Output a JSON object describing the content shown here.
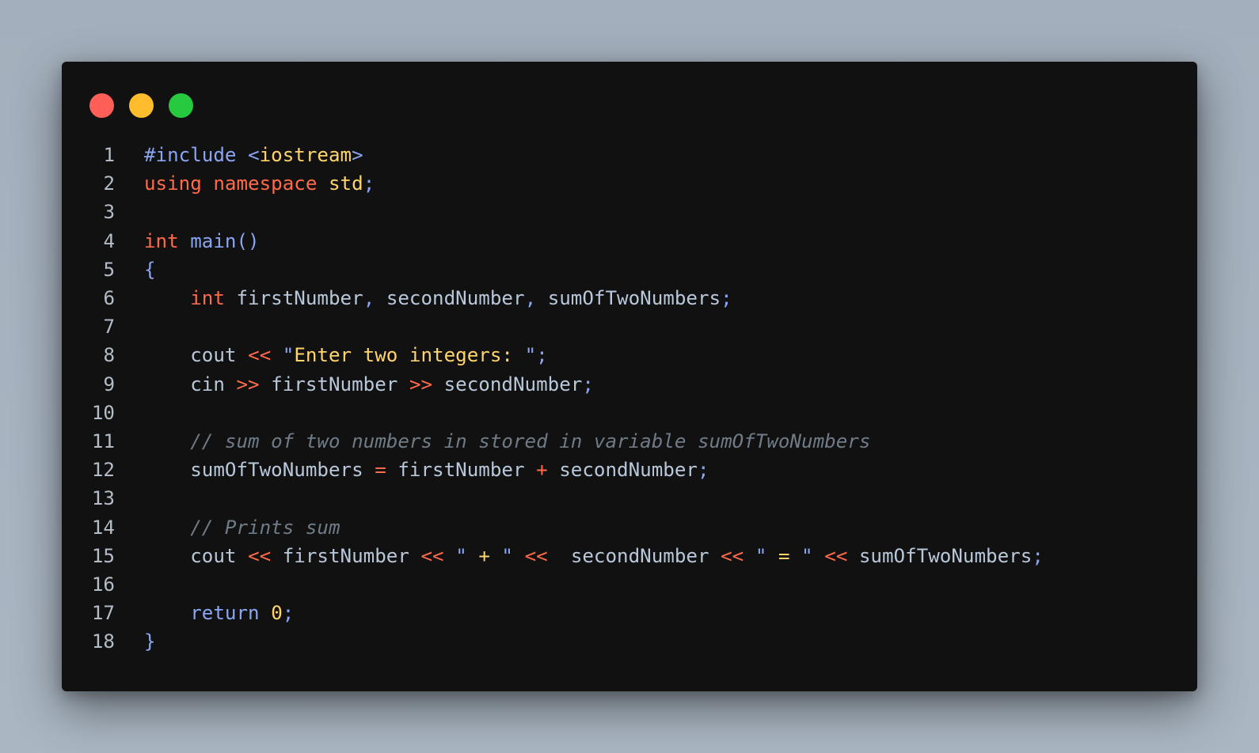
{
  "window": {
    "controls": [
      "close",
      "minimize",
      "maximize"
    ]
  },
  "code": {
    "lines": [
      {
        "num": "1",
        "tokens": [
          {
            "t": "#include ",
            "c": "blue"
          },
          {
            "t": "<",
            "c": "blue"
          },
          {
            "t": "iostream",
            "c": "yellow"
          },
          {
            "t": ">",
            "c": "blue"
          }
        ]
      },
      {
        "num": "2",
        "tokens": [
          {
            "t": "using ",
            "c": "kw"
          },
          {
            "t": "namespace ",
            "c": "kw"
          },
          {
            "t": "std",
            "c": "yellow"
          },
          {
            "t": ";",
            "c": "blue"
          }
        ]
      },
      {
        "num": "3",
        "tokens": []
      },
      {
        "num": "4",
        "tokens": [
          {
            "t": "int ",
            "c": "kw"
          },
          {
            "t": "main",
            "c": "blue"
          },
          {
            "t": "()",
            "c": "blue"
          }
        ]
      },
      {
        "num": "5",
        "tokens": [
          {
            "t": "{",
            "c": "blue"
          }
        ]
      },
      {
        "num": "6",
        "tokens": [
          {
            "t": "    int ",
            "c": "kw"
          },
          {
            "t": "firstNumber",
            "c": "text"
          },
          {
            "t": ", ",
            "c": "blue"
          },
          {
            "t": "secondNumber",
            "c": "text"
          },
          {
            "t": ", ",
            "c": "blue"
          },
          {
            "t": "sumOfTwoNumbers",
            "c": "text"
          },
          {
            "t": ";",
            "c": "blue"
          }
        ]
      },
      {
        "num": "7",
        "tokens": []
      },
      {
        "num": "8",
        "tokens": [
          {
            "t": "    cout ",
            "c": "text"
          },
          {
            "t": "<< ",
            "c": "op"
          },
          {
            "t": "\"",
            "c": "blue"
          },
          {
            "t": "Enter two integers: ",
            "c": "yellow"
          },
          {
            "t": "\"",
            "c": "blue"
          },
          {
            "t": ";",
            "c": "blue"
          }
        ]
      },
      {
        "num": "9",
        "tokens": [
          {
            "t": "    cin ",
            "c": "text"
          },
          {
            "t": ">> ",
            "c": "op"
          },
          {
            "t": "firstNumber ",
            "c": "text"
          },
          {
            "t": ">> ",
            "c": "op"
          },
          {
            "t": "secondNumber",
            "c": "text"
          },
          {
            "t": ";",
            "c": "blue"
          }
        ]
      },
      {
        "num": "10",
        "tokens": []
      },
      {
        "num": "11",
        "tokens": [
          {
            "t": "    // sum of two numbers in stored in variable sumOfTwoNumbers",
            "c": "comment"
          }
        ]
      },
      {
        "num": "12",
        "tokens": [
          {
            "t": "    sumOfTwoNumbers ",
            "c": "text"
          },
          {
            "t": "= ",
            "c": "op"
          },
          {
            "t": "firstNumber ",
            "c": "text"
          },
          {
            "t": "+ ",
            "c": "op"
          },
          {
            "t": "secondNumber",
            "c": "text"
          },
          {
            "t": ";",
            "c": "blue"
          }
        ]
      },
      {
        "num": "13",
        "tokens": []
      },
      {
        "num": "14",
        "tokens": [
          {
            "t": "    // Prints sum",
            "c": "comment"
          }
        ]
      },
      {
        "num": "15",
        "tokens": [
          {
            "t": "    cout ",
            "c": "text"
          },
          {
            "t": "<< ",
            "c": "op"
          },
          {
            "t": "firstNumber ",
            "c": "text"
          },
          {
            "t": "<< ",
            "c": "op"
          },
          {
            "t": "\" ",
            "c": "blue"
          },
          {
            "t": "+",
            "c": "yellow"
          },
          {
            "t": " \" ",
            "c": "blue"
          },
          {
            "t": "<<  ",
            "c": "op"
          },
          {
            "t": "secondNumber ",
            "c": "text"
          },
          {
            "t": "<< ",
            "c": "op"
          },
          {
            "t": "\" ",
            "c": "blue"
          },
          {
            "t": "=",
            "c": "yellow"
          },
          {
            "t": " \" ",
            "c": "blue"
          },
          {
            "t": "<< ",
            "c": "op"
          },
          {
            "t": "sumOfTwoNumbers",
            "c": "text"
          },
          {
            "t": ";",
            "c": "blue"
          }
        ]
      },
      {
        "num": "16",
        "tokens": []
      },
      {
        "num": "17",
        "tokens": [
          {
            "t": "    return ",
            "c": "blue"
          },
          {
            "t": "0",
            "c": "num"
          },
          {
            "t": ";",
            "c": "blue"
          }
        ]
      },
      {
        "num": "18",
        "tokens": [
          {
            "t": "}",
            "c": "blue"
          }
        ]
      }
    ]
  },
  "colors": {
    "background": "#a7b3c0",
    "window": "#111111",
    "close": "#ff5f56",
    "minimize": "#ffbd2e",
    "maximize": "#27c93f",
    "keyword": "#ff6b4a",
    "identifier": "#b8c7d9",
    "punctuation": "#8aa6f2",
    "string": "#ffd56b",
    "comment": "#6f7b87"
  }
}
